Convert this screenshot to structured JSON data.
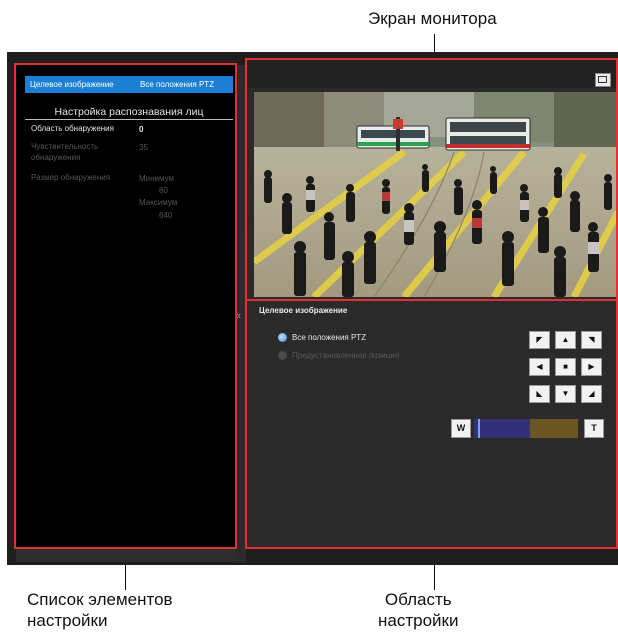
{
  "callouts": {
    "monitor": "Экран монитора",
    "settings_list": [
      "Список элементов",
      "настройки"
    ],
    "settings_area": [
      "Область",
      "настройки"
    ]
  },
  "left_panel": {
    "target_label": "Целевое изображение",
    "target_value": "Все положения PTZ",
    "section_title": "Настройка распознавания лиц",
    "detection_area_label": "Область обнаружения",
    "detection_area_value": "0",
    "sensitivity_label_1": "Чувствительность",
    "sensitivity_label_2": "обнаружения",
    "sensitivity_value": "35",
    "size_label": "Размер обнаружения",
    "min_label": "Минимум",
    "min_value": "80",
    "max_label": "Максимум",
    "max_value": "640"
  },
  "right_panel": {
    "collapse_glyph": "«",
    "title": "Целевое изображение",
    "radio_all": "Все положения PTZ",
    "radio_preset": "Предустановленная позиция",
    "zoom_wide": "W",
    "zoom_tele": "T",
    "zoom_level": 0.02,
    "pad": {
      "up_left": "◤",
      "up": "▲",
      "up_right": "◥",
      "left": "◀",
      "center": "■",
      "right": "▶",
      "down_left": "◣",
      "down": "▼",
      "down_right": "◢"
    }
  },
  "colors": {
    "highlight": "#e03030",
    "selection": "#1c7fd3",
    "zoom_track": "#332f78",
    "zoom_optical": "#6b5520"
  }
}
